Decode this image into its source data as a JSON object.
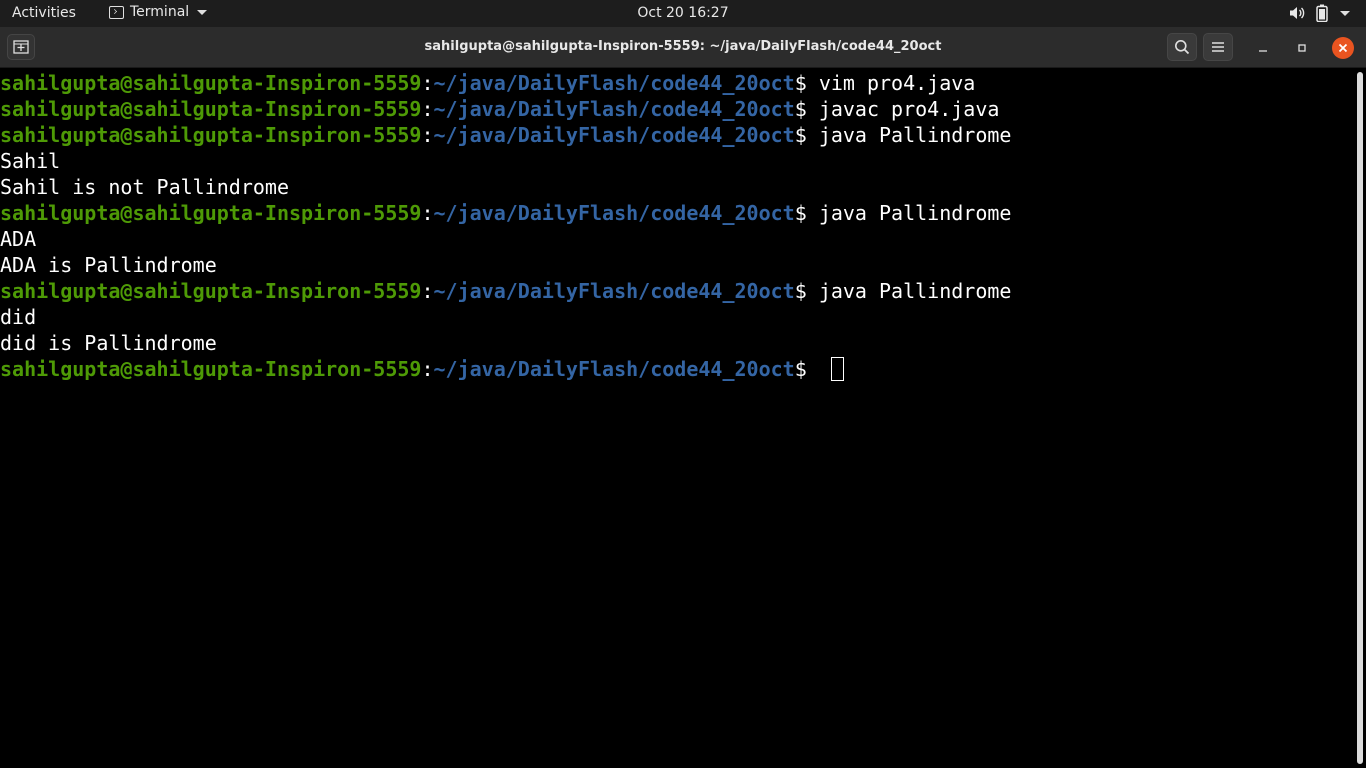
{
  "topbar": {
    "activities": "Activities",
    "app_name": "Terminal",
    "clock": "Oct 20  16:27",
    "icons": [
      "volume-icon",
      "battery-icon"
    ]
  },
  "window": {
    "title": "sahilgupta@sahilgupta-Inspiron-5559: ~/java/DailyFlash/code44_20oct",
    "buttons": [
      "new-tab-icon",
      "search-icon",
      "hamburger-menu-icon",
      "minimize-icon",
      "maximize-icon",
      "close-icon"
    ]
  },
  "terminal": {
    "prompt_user": "sahilgupta@sahilgupta-Inspiron-5559",
    "prompt_sep": ":",
    "prompt_path": "~/java/DailyFlash/code44_20oct",
    "prompt_dollar": "$ ",
    "lines": [
      {
        "type": "prompt",
        "cmd": "vim pro4.java"
      },
      {
        "type": "prompt",
        "cmd": "javac pro4.java"
      },
      {
        "type": "prompt",
        "cmd": "java Pallindrome"
      },
      {
        "type": "output",
        "text": "Sahil"
      },
      {
        "type": "output",
        "text": "Sahil is not Pallindrome"
      },
      {
        "type": "prompt",
        "cmd": "java Pallindrome"
      },
      {
        "type": "output",
        "text": "ADA"
      },
      {
        "type": "output",
        "text": "ADA is Pallindrome"
      },
      {
        "type": "prompt",
        "cmd": "java Pallindrome"
      },
      {
        "type": "output",
        "text": "did"
      },
      {
        "type": "output",
        "text": "did is Pallindrome"
      },
      {
        "type": "prompt",
        "cmd": ""
      }
    ]
  },
  "colors": {
    "prompt_user": "#4e9a06",
    "prompt_path": "#3465a4",
    "close_button": "#e95420"
  }
}
